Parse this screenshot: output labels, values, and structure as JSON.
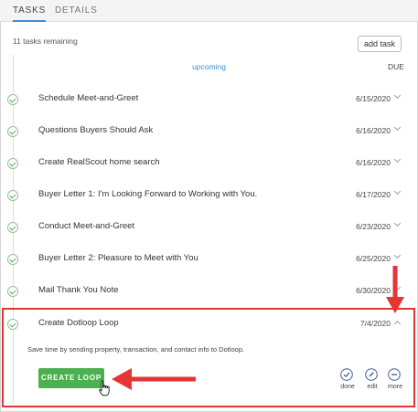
{
  "tabs": [
    {
      "label": "TASKS",
      "active": true
    },
    {
      "label": "DETAILS",
      "active": false
    }
  ],
  "header": {
    "remaining": "11 tasks remaining",
    "add_task_label": "add task",
    "section_label": "upcoming",
    "due_label": "DUE"
  },
  "tasks": [
    {
      "title": "Schedule Meet-and-Greet",
      "date": "6/15/2020",
      "done": true
    },
    {
      "title": "Questions Buyers Should Ask",
      "date": "6/16/2020",
      "done": true
    },
    {
      "title": "Create RealScout home search",
      "date": "6/16/2020",
      "done": true
    },
    {
      "title": "Buyer Letter 1: I'm Looking Forward to Working with You.",
      "date": "6/17/2020",
      "done": true
    },
    {
      "title": "Conduct Meet-and-Greet",
      "date": "6/23/2020",
      "done": true
    },
    {
      "title": "Buyer Letter 2: Pleasure to Meet with You",
      "date": "6/25/2020",
      "done": true
    },
    {
      "title": "Mail Thank You Note",
      "date": "6/30/2020",
      "done": true
    },
    {
      "title": "Create Dotloop Loop",
      "date": "7/4/2020",
      "done": true
    }
  ],
  "expanded": {
    "description": "Save time by sending property, transaction, and contact info to Dotloop.",
    "primary_button": "CREATE LOOP",
    "actions": [
      {
        "label": "done",
        "icon": "check-circle-icon"
      },
      {
        "label": "edit",
        "icon": "pencil-circle-icon"
      },
      {
        "label": "more",
        "icon": "minus-circle-icon"
      }
    ]
  },
  "colors": {
    "accent_blue": "#3a8fd6",
    "check_green": "#5aa95a",
    "button_green": "#4caf50",
    "highlight_red": "#e53535"
  }
}
